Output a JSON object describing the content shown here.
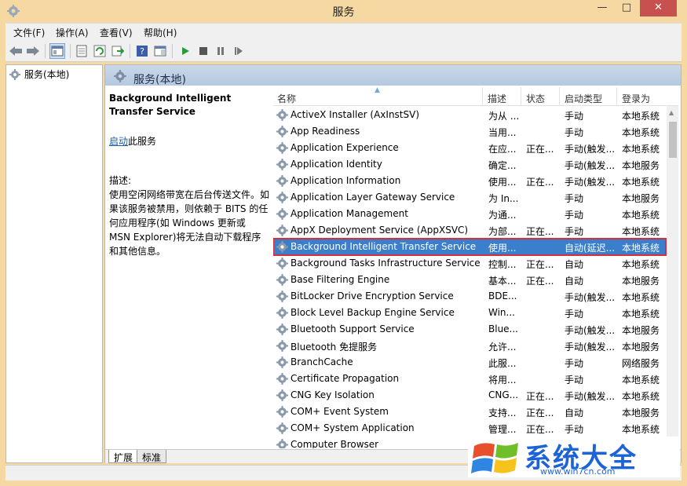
{
  "window": {
    "title": "服务",
    "minimize": "—",
    "maximize": "□",
    "close": "✕"
  },
  "menu": [
    "文件(F)",
    "操作(A)",
    "查看(V)",
    "帮助(H)"
  ],
  "tree": {
    "item": "服务(本地)"
  },
  "panel": {
    "header": "服务(本地)",
    "service_name": "Background Intelligent Transfer Service",
    "start_link": "启动",
    "start_suffix": "此服务",
    "desc_label": "描述:",
    "desc_text": "使用空闲网络带宽在后台传送文件。如果该服务被禁用，则依赖于 BITS 的任何应用程序(如 Windows 更新或 MSN Explorer)将无法自动下载程序和其他信息。"
  },
  "columns": {
    "name": "名称",
    "desc": "描述",
    "status": "状态",
    "startup": "启动类型",
    "logon": "登录为"
  },
  "rows": [
    {
      "name": "ActiveX Installer (AxInstSV)",
      "desc": "为从 ...",
      "status": "",
      "startup": "手动",
      "logon": "本地系统"
    },
    {
      "name": "App Readiness",
      "desc": "当用...",
      "status": "",
      "startup": "手动",
      "logon": "本地系统"
    },
    {
      "name": "Application Experience",
      "desc": "在应...",
      "status": "正在...",
      "startup": "手动(触发...",
      "logon": "本地系统"
    },
    {
      "name": "Application Identity",
      "desc": "确定...",
      "status": "",
      "startup": "手动(触发...",
      "logon": "本地服务"
    },
    {
      "name": "Application Information",
      "desc": "使用...",
      "status": "正在...",
      "startup": "手动(触发...",
      "logon": "本地系统"
    },
    {
      "name": "Application Layer Gateway Service",
      "desc": "为 In...",
      "status": "",
      "startup": "手动",
      "logon": "本地服务"
    },
    {
      "name": "Application Management",
      "desc": "为通...",
      "status": "",
      "startup": "手动",
      "logon": "本地系统"
    },
    {
      "name": "AppX Deployment Service (AppXSVC)",
      "desc": "为部...",
      "status": "正在...",
      "startup": "手动",
      "logon": "本地系统"
    },
    {
      "name": "Background Intelligent Transfer Service",
      "desc": "使用...",
      "status": "",
      "startup": "自动(延迟...",
      "logon": "本地系统"
    },
    {
      "name": "Background Tasks Infrastructure Service",
      "desc": "控制...",
      "status": "正在...",
      "startup": "自动",
      "logon": "本地系统"
    },
    {
      "name": "Base Filtering Engine",
      "desc": "基本...",
      "status": "正在...",
      "startup": "自动",
      "logon": "本地服务"
    },
    {
      "name": "BitLocker Drive Encryption Service",
      "desc": "BDE...",
      "status": "",
      "startup": "手动(触发...",
      "logon": "本地系统"
    },
    {
      "name": "Block Level Backup Engine Service",
      "desc": "Win...",
      "status": "",
      "startup": "手动",
      "logon": "本地系统"
    },
    {
      "name": "Bluetooth Support Service",
      "desc": "Blue...",
      "status": "",
      "startup": "手动(触发...",
      "logon": "本地服务"
    },
    {
      "name": "Bluetooth 免提服务",
      "desc": "允许...",
      "status": "",
      "startup": "手动(触发...",
      "logon": "本地服务"
    },
    {
      "name": "BranchCache",
      "desc": "此服...",
      "status": "",
      "startup": "手动",
      "logon": "网络服务"
    },
    {
      "name": "Certificate Propagation",
      "desc": "将用...",
      "status": "",
      "startup": "手动",
      "logon": "本地系统"
    },
    {
      "name": "CNG Key Isolation",
      "desc": "CNG...",
      "status": "正在...",
      "startup": "手动(触发...",
      "logon": "本地系统"
    },
    {
      "name": "COM+ Event System",
      "desc": "支持...",
      "status": "正在...",
      "startup": "自动",
      "logon": "本地服务"
    },
    {
      "name": "COM+ System Application",
      "desc": "管理...",
      "status": "正在...",
      "startup": "手动",
      "logon": "本地系统"
    },
    {
      "name": "Computer Browser",
      "desc": "",
      "status": "",
      "startup": "",
      "logon": ""
    }
  ],
  "selected_index": 8,
  "tabs": {
    "extended": "扩展",
    "standard": "标准"
  },
  "watermark": {
    "text": "系统大全",
    "url": "www.win7cn.com"
  },
  "colors": {
    "selection": "#3b7fcc",
    "highlight_border": "#d3323a",
    "title_bg": "#f6d9a2",
    "close_btn": "#c7514e"
  }
}
